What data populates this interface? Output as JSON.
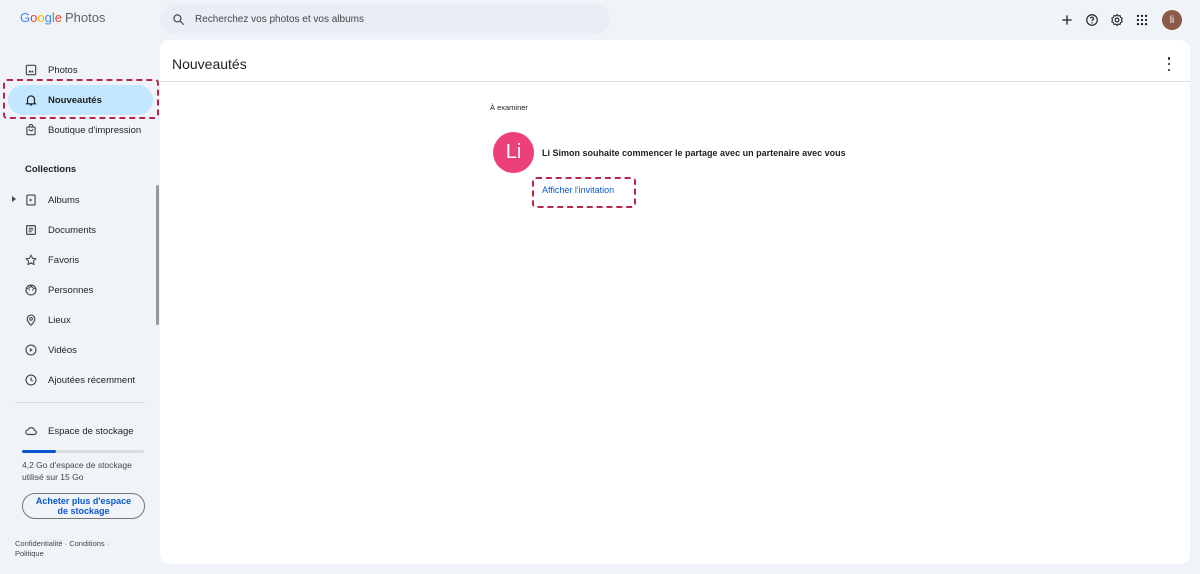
{
  "app": {
    "logo_word": "Google",
    "logo_product": "Photos"
  },
  "search": {
    "placeholder": "Recherchez vos photos et vos albums"
  },
  "topbar": {
    "icons": [
      "add-icon",
      "help-icon",
      "settings-icon",
      "apps-grid-icon"
    ],
    "avatar_initials": "li"
  },
  "sidebar": {
    "items": [
      {
        "label": "Photos",
        "icon": "photo-icon"
      },
      {
        "label": "Nouveautés",
        "icon": "bell-icon",
        "active": true
      },
      {
        "label": "Boutique d'impression",
        "icon": "shopping-bag-icon"
      }
    ],
    "collections_title": "Collections",
    "collections": [
      {
        "label": "Albums",
        "icon": "album-icon"
      },
      {
        "label": "Documents",
        "icon": "document-icon"
      },
      {
        "label": "Favoris",
        "icon": "star-icon"
      },
      {
        "label": "Personnes",
        "icon": "face-icon"
      },
      {
        "label": "Lieux",
        "icon": "location-pin-icon"
      },
      {
        "label": "Vidéos",
        "icon": "play-circle-icon"
      },
      {
        "label": "Ajoutées récemment",
        "icon": "clock-icon"
      }
    ],
    "storage": {
      "label": "Espace de stockage",
      "used_fraction": 0.28,
      "text": "4,2 Go d'espace de stockage utilisé sur 15 Go",
      "buy_button": "Acheter plus d'espace de stockage"
    },
    "footer": {
      "privacy": "Confidentialité",
      "terms": "Conditions",
      "policy": "Politique",
      "separator": "·"
    }
  },
  "main": {
    "title": "Nouveautés",
    "section_label": "À examiner",
    "notification": {
      "avatar_initials": "Li",
      "avatar_color": "#ec407a",
      "message": "Li Simon souhaite commencer le partage avec un partenaire avec vous",
      "action_link": "Afficher l'invitation"
    }
  },
  "colors": {
    "active_nav_bg": "#c2e7ff",
    "link": "#0b57d0",
    "annotation": "#b5284a"
  }
}
